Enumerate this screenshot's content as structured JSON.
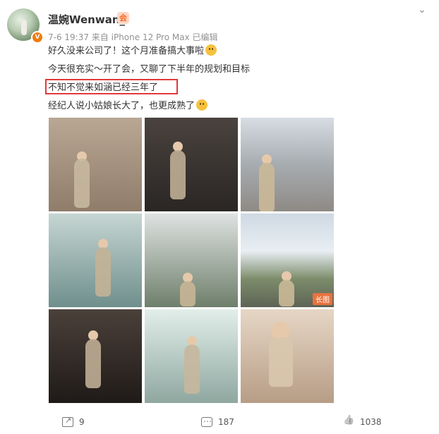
{
  "post": {
    "author": "温婉Wenwan_",
    "verified_badge": "V",
    "member_badge": "会",
    "meta": "7-6 19:37  来自 iPhone 12 Pro Max 已编辑",
    "more_icon": "chevron-down-icon",
    "lines": [
      "好久没来公司了！这个月准备搞大事啦",
      "今天很充实～开了会，又聊了下半年的规划和目标",
      "不知不觉来如涵已经三年了",
      "经纪人说小姑娘长大了，也更成熟了"
    ],
    "photo_tag": "长图"
  },
  "actions": {
    "share_count": "9",
    "comment_count": "187",
    "like_count": "1038"
  },
  "colors": {
    "highlight": "#e23a3a",
    "accent": "#f17a0a",
    "meta": "#939393"
  }
}
